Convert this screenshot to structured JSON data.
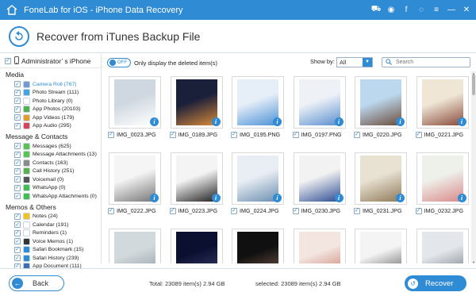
{
  "window": {
    "title": "FoneLab for iOS - iPhone Data Recovery",
    "tools": [
      {
        "icon": "cart-icon"
      },
      {
        "icon": "wifi-icon"
      },
      {
        "icon": "facebook-icon"
      },
      {
        "icon": "chat-icon"
      },
      {
        "icon": "menu-icon"
      },
      {
        "icon": "minimize-icon"
      },
      {
        "icon": "close-icon"
      }
    ]
  },
  "header": {
    "title": "Recover from iTunes Backup File"
  },
  "sidebar": {
    "device": "Administrator’ s iPhone",
    "sections": [
      {
        "title": "Media",
        "items": [
          {
            "label": "Camera Roll (767)",
            "color": "#6e9bd6",
            "checked": true,
            "active": true
          },
          {
            "label": "Photo Stream (111)",
            "color": "#43a6e0",
            "checked": true
          },
          {
            "label": "Photo Library (0)",
            "color": "#ffffff",
            "checked": true
          },
          {
            "label": "App Photos (20103)",
            "color": "#4fb24f",
            "checked": true
          },
          {
            "label": "App Videos (179)",
            "color": "#e89a2c",
            "checked": true
          },
          {
            "label": "App Audio (295)",
            "color": "#d9435a",
            "checked": true
          }
        ]
      },
      {
        "title": "Message & Contacts",
        "items": [
          {
            "label": "Messages (625)",
            "color": "#57c44f",
            "checked": true
          },
          {
            "label": "Message Attachments (13)",
            "color": "#57c44f",
            "checked": true
          },
          {
            "label": "Contacts (163)",
            "color": "#8a8a8a",
            "checked": true
          },
          {
            "label": "Call History (251)",
            "color": "#56b34b",
            "checked": true
          },
          {
            "label": "Voicemail (0)",
            "color": "#555555",
            "checked": true
          },
          {
            "label": "WhatsApp (0)",
            "color": "#3fbf4f",
            "checked": true
          },
          {
            "label": "WhatsApp Attachments (0)",
            "color": "#3fbf4f",
            "checked": true
          }
        ]
      },
      {
        "title": "Memos & Others",
        "items": [
          {
            "label": "Notes (24)",
            "color": "#f2c21f",
            "checked": true
          },
          {
            "label": "Calendar (191)",
            "color": "#ffffff",
            "checked": true
          },
          {
            "label": "Reminders (1)",
            "color": "#ffffff",
            "checked": true
          },
          {
            "label": "Voice Memos (1)",
            "color": "#333333",
            "checked": true
          },
          {
            "label": "Safari Bookmark (15)",
            "color": "#2f8bd4",
            "checked": true
          },
          {
            "label": "Safari History (239)",
            "color": "#2f8bd4",
            "checked": true
          },
          {
            "label": "App Document (111)",
            "color": "#3b6fb6",
            "checked": true
          }
        ]
      }
    ]
  },
  "toolbar": {
    "toggle_state": "OFF",
    "toggle_text": "Only display the deleted item(s)",
    "show_by_label": "Show by:",
    "show_by_value": "All",
    "search_placeholder": "Search"
  },
  "grid": {
    "items": [
      {
        "name": "IMG_0023.JPG",
        "checked": true,
        "colors": [
          "#cfd8e0",
          "#ffffff"
        ]
      },
      {
        "name": "IMG_0189.JPG",
        "checked": true,
        "colors": [
          "#1a1f3a",
          "#d88a3a"
        ]
      },
      {
        "name": "IMG_0195.PNG",
        "checked": true,
        "colors": [
          "#e6eef7",
          "#4b91d8"
        ]
      },
      {
        "name": "IMG_0197.PNG",
        "checked": true,
        "colors": [
          "#eef2f7",
          "#5a8fd0"
        ]
      },
      {
        "name": "IMG_0220.JPG",
        "checked": true,
        "colors": [
          "#bcd8ee",
          "#6b4c3a"
        ]
      },
      {
        "name": "IMG_0221.JPG",
        "checked": true,
        "colors": [
          "#efe6d6",
          "#8a4a3a"
        ]
      },
      {
        "name": "IMG_0222.JPG",
        "checked": true,
        "colors": [
          "#f5f5f5",
          "#777777"
        ]
      },
      {
        "name": "IMG_0223.JPG",
        "checked": true,
        "colors": [
          "#f4f4f4",
          "#222222"
        ]
      },
      {
        "name": "IMG_0224.JPG",
        "checked": true,
        "colors": [
          "#e9eef4",
          "#6c8fb0"
        ]
      },
      {
        "name": "IMG_0230.JPG",
        "checked": true,
        "colors": [
          "#f2f2f2",
          "#2e4e94"
        ]
      },
      {
        "name": "IMG_0231.JPG",
        "checked": true,
        "colors": [
          "#e8e2d3",
          "#8f7a5a"
        ]
      },
      {
        "name": "IMG_0232.JPG",
        "checked": true,
        "colors": [
          "#eef0ea",
          "#d98a8a"
        ]
      },
      {
        "name": "",
        "checked": false,
        "colors": [
          "#d2d9dc",
          "#8d9aa3"
        ]
      },
      {
        "name": "",
        "checked": false,
        "colors": [
          "#0c1030",
          "#3a3f70"
        ]
      },
      {
        "name": "",
        "checked": false,
        "colors": [
          "#101010",
          "#7a5a4a"
        ]
      },
      {
        "name": "",
        "checked": false,
        "colors": [
          "#f3e6e0",
          "#c87a6a"
        ]
      },
      {
        "name": "",
        "checked": false,
        "colors": [
          "#f4f4f4",
          "#555555"
        ]
      },
      {
        "name": "",
        "checked": false,
        "colors": [
          "#e3e6ea",
          "#6f7a86"
        ]
      }
    ]
  },
  "footer": {
    "back_label": "Back",
    "total_text": "Total: 23089 item(s) 2.94 GB",
    "selected_text": "selected: 23089 item(s) 2.94 GB",
    "recover_label": "Recover"
  }
}
